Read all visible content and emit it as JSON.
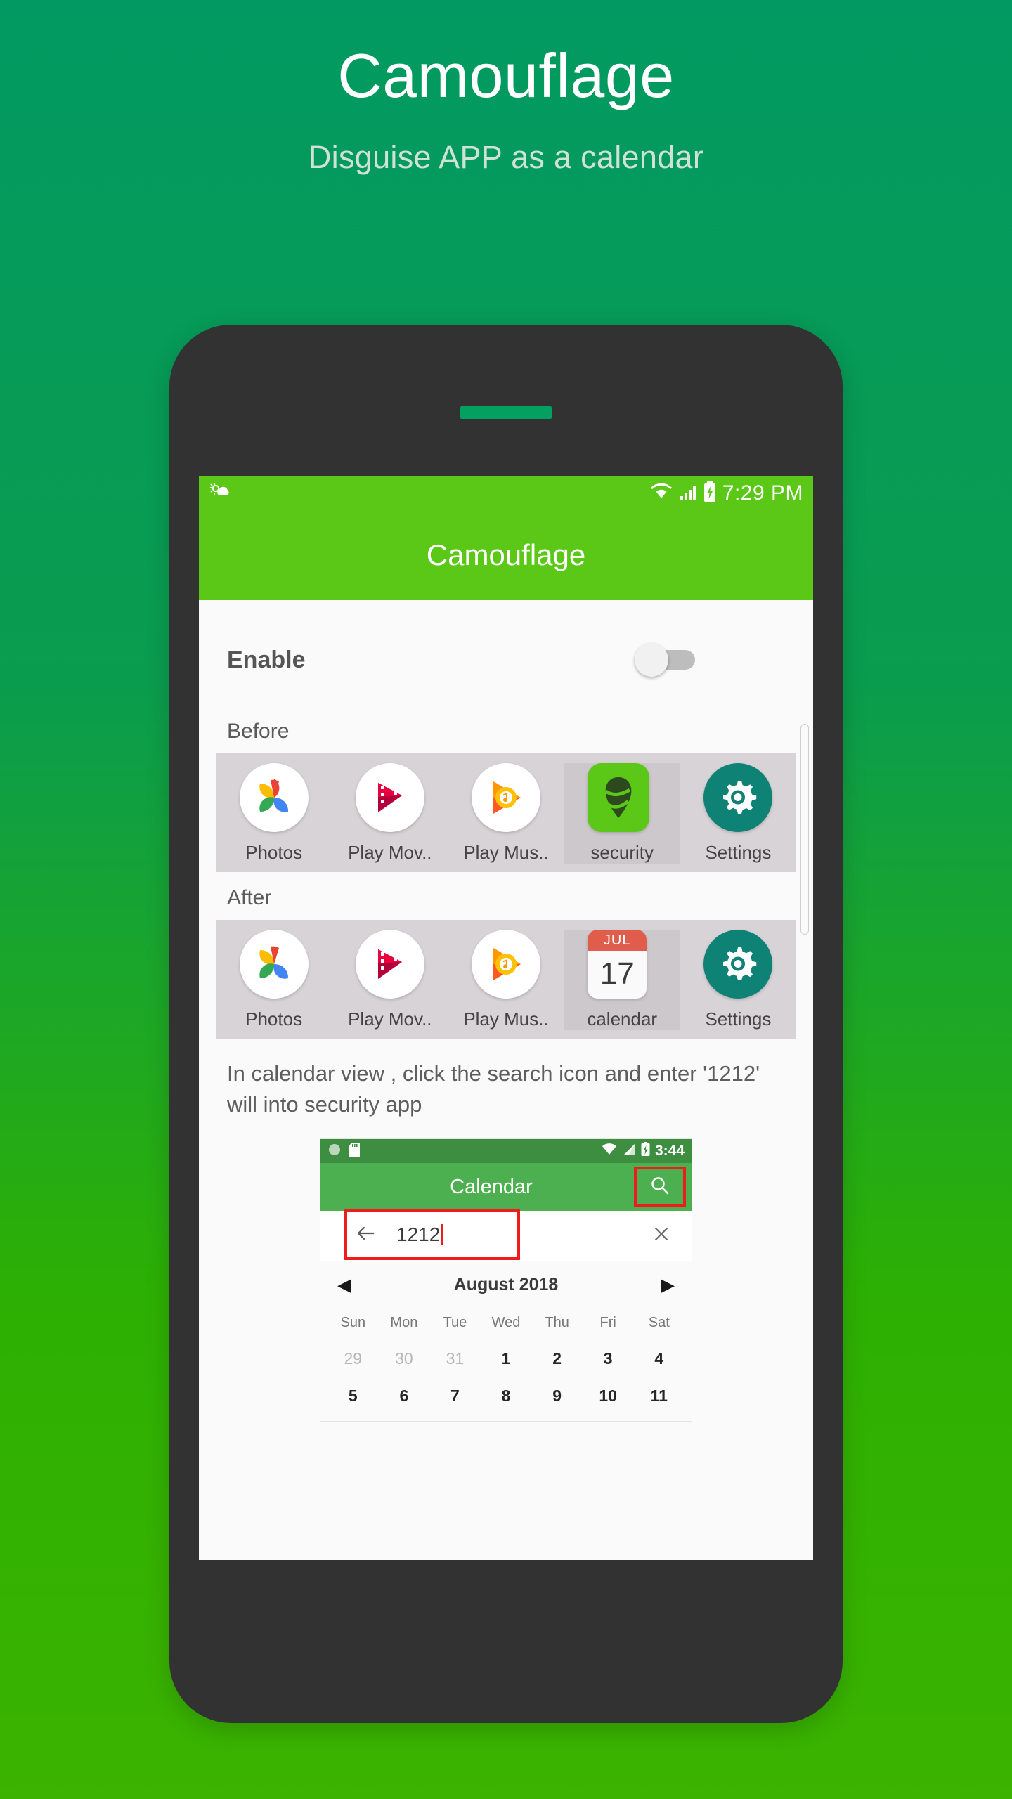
{
  "hero": {
    "title": "Camouflage",
    "subtitle": "Disguise APP as a calendar"
  },
  "colors": {
    "bg_top": "#029a62",
    "bg_bottom": "#3bb300",
    "appbar": "#5bc717",
    "phone_body": "#323232",
    "highlight_red": "#ee1c1c",
    "inner_appbar": "#4caf50",
    "inner_status": "#3e8e41"
  },
  "phone": {
    "statusbar": {
      "weather_icon": "weather-sun-cloud-icon",
      "wifi_icon": "wifi-icon",
      "signal_icon": "cellular-signal-icon",
      "battery_icon": "battery-charging-icon",
      "time": "7:29 PM"
    },
    "appbar": {
      "title": "Camouflage"
    },
    "enable_row": {
      "label": "Enable",
      "toggle_state": "off"
    },
    "before": {
      "label": "Before",
      "apps": [
        {
          "name": "Photos",
          "icon": "google-photos-icon"
        },
        {
          "name": "Play Mov..",
          "icon": "google-play-movies-icon"
        },
        {
          "name": "Play Mus..",
          "icon": "google-play-music-icon"
        },
        {
          "name": "security",
          "icon": "security-app-icon"
        },
        {
          "name": "Settings",
          "icon": "settings-gear-icon"
        }
      ]
    },
    "after": {
      "label": "After",
      "apps": [
        {
          "name": "Photos",
          "icon": "google-photos-icon"
        },
        {
          "name": "Play Mov..",
          "icon": "google-play-movies-icon"
        },
        {
          "name": "Play Mus..",
          "icon": "google-play-music-icon"
        },
        {
          "name": "calendar",
          "icon": "calendar-icon",
          "month": "JUL",
          "day": "17"
        },
        {
          "name": "Settings",
          "icon": "settings-gear-icon"
        }
      ]
    },
    "note": "In calendar view , click the search icon and enter '1212' will into security app"
  },
  "inner_screenshot": {
    "statusbar": {
      "left_icons": [
        "circle-indicator-icon",
        "sd-card-icon"
      ],
      "wifi_icon": "wifi-off-icon",
      "signal_icon": "cellular-signal-icon",
      "battery_icon": "battery-charging-icon",
      "time": "3:44"
    },
    "appbar": {
      "title": "Calendar",
      "search_icon": "search-icon"
    },
    "search_row": {
      "back_icon": "arrow-left-icon",
      "value": "1212",
      "clear_icon": "close-icon"
    },
    "month_nav": {
      "prev_icon": "triangle-left-icon",
      "title": "August 2018",
      "next_icon": "triangle-right-icon"
    },
    "weekdays": [
      "Sun",
      "Mon",
      "Tue",
      "Wed",
      "Thu",
      "Fri",
      "Sat"
    ],
    "date_rows": [
      [
        {
          "d": "29",
          "dim": true
        },
        {
          "d": "30",
          "dim": true
        },
        {
          "d": "31",
          "dim": true
        },
        {
          "d": "1",
          "dim": false
        },
        {
          "d": "2",
          "dim": false
        },
        {
          "d": "3",
          "dim": false
        },
        {
          "d": "4",
          "dim": false
        }
      ],
      [
        {
          "d": "5",
          "dim": false
        },
        {
          "d": "6",
          "dim": false
        },
        {
          "d": "7",
          "dim": false
        },
        {
          "d": "8",
          "dim": false
        },
        {
          "d": "9",
          "dim": false
        },
        {
          "d": "10",
          "dim": false
        },
        {
          "d": "11",
          "dim": false
        }
      ]
    ]
  }
}
